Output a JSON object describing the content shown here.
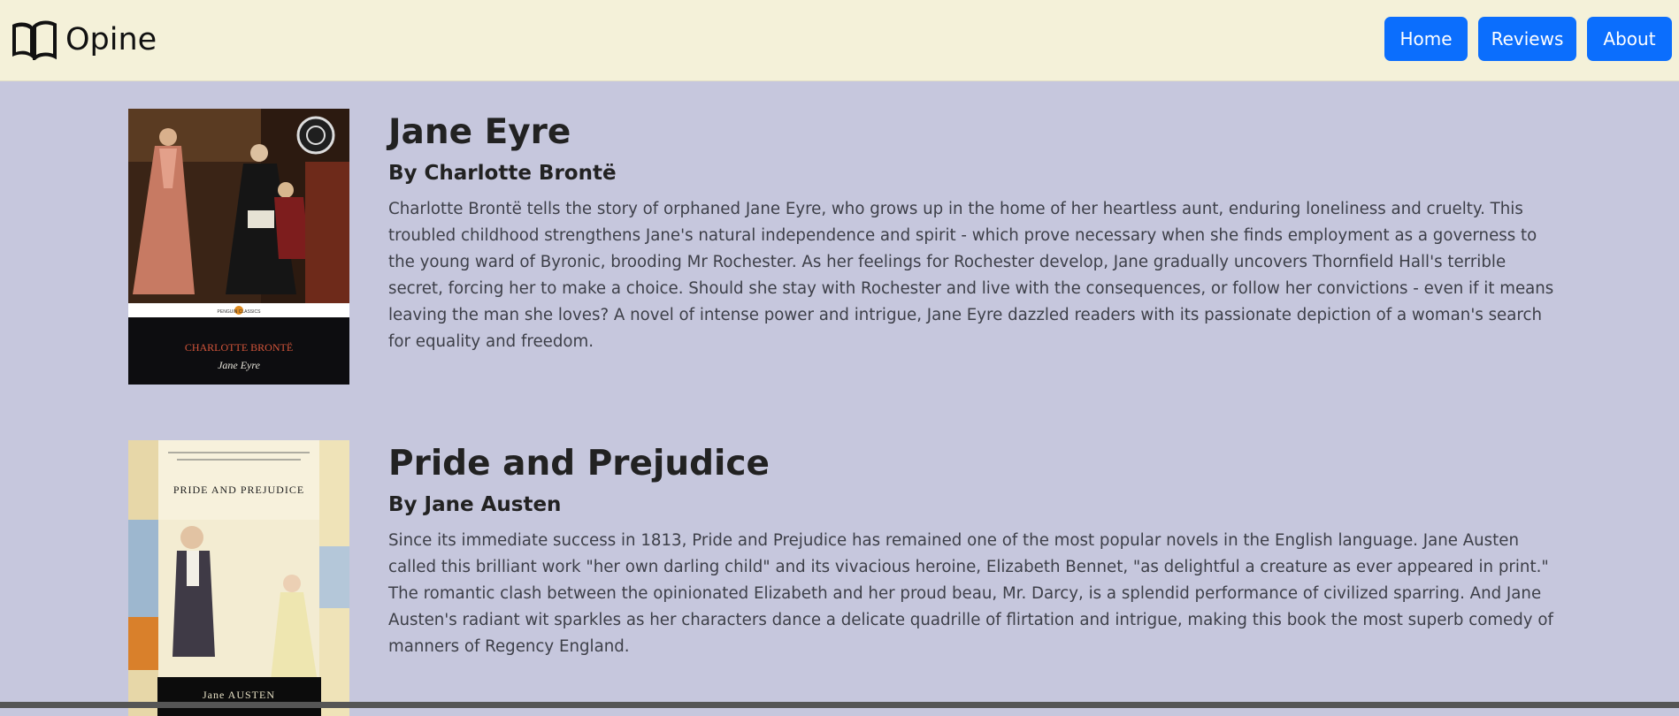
{
  "navbar": {
    "brand": "Opine",
    "home": "Home",
    "reviews": "Reviews",
    "about": "About",
    "brand_icon": "open-book-icon"
  },
  "books": [
    {
      "title": "Jane Eyre",
      "author": "By Charlotte Brontë",
      "description": "Charlotte Brontë tells the story of orphaned Jane Eyre, who grows up in the home of her heartless aunt, enduring loneliness and cruelty. This troubled childhood strengthens Jane's natural independence and spirit - which prove necessary when she finds employment as a governess to the young ward of Byronic, brooding Mr Rochester. As her feelings for Rochester develop, Jane gradually uncovers Thornfield Hall's terrible secret, forcing her to make a choice. Should she stay with Rochester and live with the consequences, or follow her convictions - even if it means leaving the man she loves? A novel of intense power and intrigue, Jane Eyre dazzled readers with its passionate depiction of a woman's search for equality and freedom.",
      "cover_series": "PENGUIN CLASSICS",
      "cover_author": "CHARLOTTE BRONTË",
      "cover_title": "Jane Eyre"
    },
    {
      "title": "Pride and Prejudice",
      "author": "By Jane Austen",
      "description": "Since its immediate success in 1813, Pride and Prejudice has remained one of the most popular novels in the English language. Jane Austen called this brilliant work \"her own darling child\" and its vivacious heroine, Elizabeth Bennet, \"as delightful a creature as ever appeared in print.\" The romantic clash between the opinionated Elizabeth and her proud beau, Mr. Darcy, is a splendid performance of civilized sparring. And Jane Austen's radiant wit sparkles as her characters dance a delicate quadrille of flirtation and intrigue, making this book the most superb comedy of manners of Regency England.",
      "cover_title": "PRIDE AND PREJUDICE",
      "cover_author": "Jane AUSTEN"
    }
  ],
  "colors": {
    "navbar_bg": "#f4f1d9",
    "page_bg": "#c6c7dd",
    "button_bg": "#0b6efd"
  }
}
